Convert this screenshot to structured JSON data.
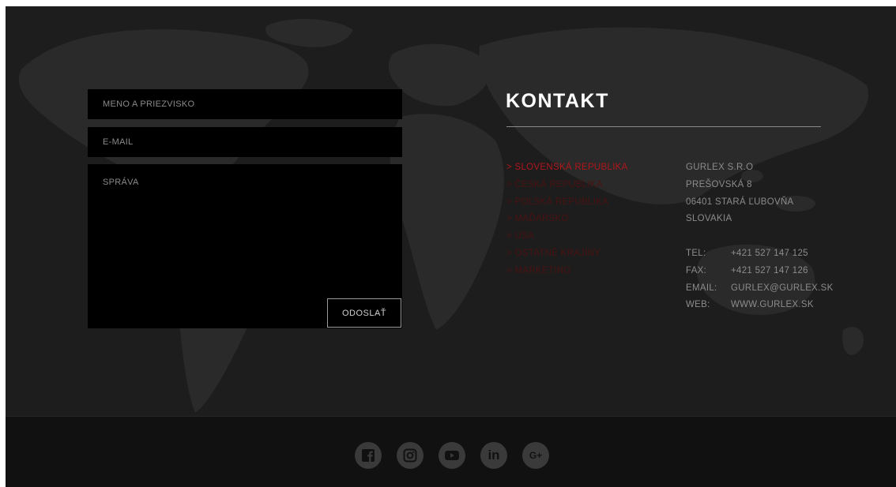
{
  "form": {
    "name_placeholder": "MENO A PRIEZVISKO",
    "email_placeholder": "E-MAIL",
    "message_placeholder": "SPRÁVA",
    "submit_label": "ODOSLAŤ"
  },
  "contact": {
    "title": "KONTAKT",
    "countries": [
      {
        "label": "> SLOVENSKÁ REPUBLIKA",
        "active": true
      },
      {
        "label": "> ČESKÁ REPUBLIKA",
        "active": false
      },
      {
        "label": "> POĽSKÁ REPUBLIKA",
        "active": false
      },
      {
        "label": "> MAĎARSKO",
        "active": false
      },
      {
        "label": "> USA",
        "active": false
      },
      {
        "label": "> OSTATNÉ KRAJINY",
        "active": false
      },
      {
        "label": "> MARKETING",
        "active": false
      }
    ],
    "address": [
      "GURLEX S.R.O",
      "PREŠOVSKÁ 8",
      "06401 STARÁ ĽUBOVŇA",
      "SLOVAKIA"
    ],
    "details": [
      {
        "label": "TEL:",
        "value": "+421 527 147 125"
      },
      {
        "label": "FAX:",
        "value": "+421 527 147 126"
      },
      {
        "label": "EMAIL:",
        "value": "GURLEX@GURLEX.SK"
      },
      {
        "label": "WEB:",
        "value": "WWW.GURLEX.SK"
      }
    ]
  },
  "footer": {
    "social_icons": [
      "facebook-icon",
      "instagram-icon",
      "youtube-icon",
      "linkedin-icon",
      "google-plus-icon"
    ],
    "linkedin_text": "in",
    "google_plus_text": "G+"
  },
  "colors": {
    "background": "#1d1d1d",
    "accent_red": "#b0161c",
    "dim_red": "#4a1212",
    "footer": "#111111"
  }
}
